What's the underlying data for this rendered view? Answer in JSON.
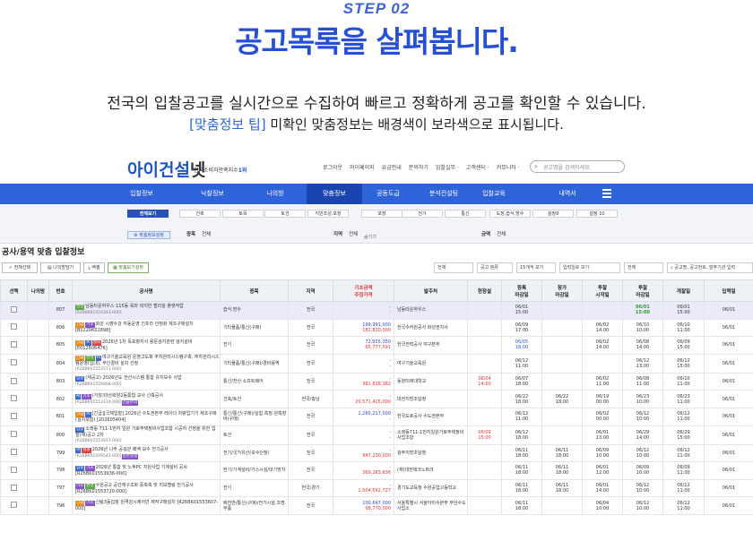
{
  "hero": {
    "step": "STEP 02",
    "headline": "공고목록을 살펴봅니다.",
    "line1": "전국의 입찰공고를 실시간으로 수집하여 빠르고 정확하게 공고를 확인할 수 있습니다.",
    "tip_label": "[맞춤정보 팁]",
    "tip_text": " 미확인 맞춤정보는 배경색이 보라색으로 표시됩니다."
  },
  "topbar": {
    "logo_main": "아이건설",
    "logo_suffix": "넷",
    "logo_sub": "한국소비자만족지수",
    "logo_sub_badge": "1위",
    "links": [
      "로그아웃",
      "마이페이지",
      "요금안내",
      "문의하기",
      "입찰실무 ·",
      "고객센터 ·",
      "커뮤니티 ·"
    ],
    "search_placeholder": "공고명을 검색하세요."
  },
  "nav": {
    "items": [
      "입찰정보",
      "낙찰정보",
      "나의방",
      "맞춤정보",
      "공동도급",
      "분석컨설팅",
      "입찰교육",
      "내역서"
    ],
    "active_index": 3
  },
  "filter": {
    "tabs": [
      "전체보기",
      "건축",
      "토목",
      "토건",
      "지반조성.포장",
      "포장",
      "전기",
      "통신",
      "도장,습식,방수",
      "설정9",
      "설정 10"
    ],
    "setting_label": "맞춤정보설정",
    "type_label": "종목",
    "type_value": "전체",
    "region_label": "지역",
    "region_value": "전체",
    "amount_label": "금액",
    "amount_value": "전체",
    "collapse_label": "숨기기"
  },
  "list_title": "공사/용역 맞춤 입찰정보",
  "toolbar": {
    "select_all": "전체선택",
    "my_room": "나의방담기",
    "excel": "엑셀",
    "custom_set": "맞춤보기설정",
    "filters": [
      "전체",
      "공고 분류",
      "15개씩 보기",
      "입력일로 보기",
      "전체"
    ],
    "search_placeholder": "공고명, 공고번호, 발주기관 입력"
  },
  "table": {
    "headers": [
      "선택",
      "나의방",
      "번호",
      "공사명",
      "종목",
      "지역",
      "기초금액",
      "발주처",
      "현장설",
      "등록 마감일",
      "참가 마감일",
      "투찰 시작일",
      "투찰 마감일",
      "개찰일",
      "입력일"
    ],
    "amount_header_sub": "추정가격",
    "rows": [
      {
        "hl": true,
        "no": "807",
        "tags": [
          [
            "t-green",
            "변경"
          ]
        ],
        "title": "남동타운하우스 115동 옥마 외지반 벨리설 플랫작업",
        "ref": "[R26BK01554343-000]",
        "type": "습식.방수",
        "region": "전국",
        "base": "-",
        "est": "-",
        "agency": "남동타운하우스",
        "site": "",
        "reg": "06/01\n15:00",
        "part": "",
        "open": "",
        "close": "06/01\n15:00",
        "close_bold": true,
        "bid": "06/01\n15:00",
        "input": "06/01"
      },
      {
        "hl": false,
        "no": "806",
        "tags": [
          [
            "t-orange",
            "긴급"
          ],
          [
            "t-purple",
            "기초"
          ]
        ],
        "title": "화성 시영수강 자동운영 인프라 안정화 제조구매설치 [B1220K01898]",
        "ref": "",
        "type": "기타물품/통신(구매)",
        "region": "전국",
        "base": "199,991,000",
        "est": "181,810,000",
        "agency": "한국수자원공사 화성권지사",
        "site": "",
        "reg": "06/09\n17:00",
        "part": "",
        "open": "06/02\n14:00",
        "close": "06/10\n10:00",
        "bid": "06/10\n11:00",
        "input": "06/01"
      },
      {
        "hl": false,
        "no": "805",
        "tags": [
          [
            "t-orange",
            "긴급"
          ],
          [
            "t-blue",
            "AI"
          ],
          [
            "t-red",
            "철회"
          ]
        ],
        "title": "2026년 1차 독포항지사 용문검지관련 검지설비 [E012606476]",
        "ref": "",
        "type": "전기",
        "region": "전국",
        "base": "72,955,350",
        "est": "65,777,591",
        "agency": "한국전력공사 여구본부",
        "site": "",
        "reg": "06/05\n18:00",
        "reg_blue": true,
        "part": "",
        "open": "06/02\n14:00",
        "close": "06/08\n14:00",
        "bid": "06/09\n15:00",
        "input": "06/01"
      },
      {
        "hl": false,
        "no": "804",
        "tags": [
          [
            "t-orange",
            "긴급"
          ],
          [
            "t-green",
            "변경"
          ],
          [
            "t-blue",
            "AI"
          ]
        ],
        "title": "여구기술교육원 운영고도화 주차관리시스템구축, 주차관리시스템운영(입대), 무인결비 설치 선정",
        "ref": "[R26BK01553571-000]",
        "type": "기타물품/통신(구매)/경비용역",
        "region": "전국",
        "base": "-",
        "est": "-",
        "agency": "여구기술교육원",
        "site": "",
        "reg": "06/12\n11:00",
        "part": "",
        "open": "",
        "close": "06/12\n13:00",
        "bid": "06/12\n15:00",
        "input": "06/01"
      },
      {
        "hl": false,
        "no": "803",
        "tags": [
          [
            "t-blue",
            "입찰"
          ]
        ],
        "title": "(재공고) 2026년도 전산시스템 통합 유지보수 사업",
        "ref": "[R26BK01556868-000]",
        "type": "통신/전산.소프트웨어",
        "region": "전국",
        "base": "-",
        "est": "361,818,182",
        "agency": "동양미래대학교",
        "site": "06/04\n14:00",
        "site_red": true,
        "reg": "06/07\n18:00",
        "part": "",
        "open": "06/02\n11:00",
        "close": "06/08\n11:00",
        "bid": "06/10\n11:00",
        "input": "06/01"
      },
      {
        "hl": false,
        "no": "802",
        "tags": [
          [
            "t-blue",
            "AI"
          ],
          [
            "t-purple",
            "기초"
          ]
        ],
        "title": "(가칭)마산화양2동통합 교사 신축공사",
        "ref": "[R26BK01553114-000]",
        "ref_extra": "긴급수의",
        "type": "건축/토건",
        "region": "전국/충남",
        "base": "-",
        "est": "20,571,425,000",
        "agency": "대전지방조달청",
        "site": "",
        "reg": "06/22\n18:00",
        "part": "06/22\n18:00",
        "open": "06/19\n00:00",
        "close": "06/23\n10:00",
        "bid": "06/23\n11:00",
        "input": "06/01"
      },
      {
        "hl": false,
        "no": "801",
        "tags": [
          [
            "t-orange",
            "긴급"
          ],
          [
            "t-blue",
            "AI"
          ]
        ],
        "title": "[긴급][국제입찰] 2026년 수도권본부 레이더 차량업기기 제조구매(설치포함) [202605404]",
        "ref": "",
        "type": "통신/통신(구매)/실험.측정.관측장비(구매)",
        "region": "전국",
        "base": "1,260,217,000",
        "est": "-",
        "agency": "한국도로공사 수도권본부",
        "site": "",
        "reg": "06/12\n11:00",
        "part": "",
        "open": "06/02\n00:00",
        "close": "06/12\n10:00",
        "bid": "06/12\n11:00",
        "input": "06/01"
      },
      {
        "hl": false,
        "no": "800",
        "tags": [
          [
            "t-blue",
            "입찰"
          ]
        ],
        "title": "소래동 711-1번지 일원 가로주택정비사업조합 시공자 선정을 위한 입찰(재)공고 2차",
        "ref": "[R26BK01553917-000]",
        "type": "토건",
        "region": "전국",
        "base": "-",
        "est": "-",
        "agency": "소래동711-1번지일원가로주택정비사업조합",
        "site": "06/09\n15:00",
        "site_red": true,
        "reg": "06/12\n18:00",
        "part": "",
        "open": "06/01\n13:00",
        "close": "06/29\n14:00",
        "bid": "06/29\n15:00",
        "input": "06/01"
      },
      {
        "hl": false,
        "no": "799",
        "tags": [
          [
            "t-blue",
            "AI"
          ],
          [
            "t-red",
            "철회"
          ]
        ],
        "title": "2026년 나주 공성관 페액 보수 전기공사",
        "ref": "[R26BK01509542-000]",
        "ref_extra": "일반경쟁",
        "type": "전기/국가유산(보수단청)",
        "region": "전국",
        "base": "-",
        "est": "947,230,000",
        "agency": "광주지방조달청",
        "site": "",
        "reg": "06/11\n18:00",
        "part": "06/11\n18:00",
        "open": "06/09\n10:00",
        "close": "06/12\n10:00",
        "bid": "06/12\n11:00",
        "input": "06/01"
      },
      {
        "hl": false,
        "no": "798",
        "tags": [
          [
            "t-blue",
            "입찰"
          ],
          [
            "t-purple",
            "기초"
          ]
        ],
        "title": "2026년 통합 및 노후PC 지원사업 기계설비 공사 [R26BK01553936-000]",
        "ref": "",
        "type": "전기/기계설비/가스시설/대기방지",
        "region": "전국",
        "base": "-",
        "est": "369,263,636",
        "agency": "(재)대전테크노파크",
        "site": "",
        "reg": "06/11\n18:00",
        "part": "06/11\n18:00",
        "open": "06/01\n12:00",
        "close": "06/09\n10:00",
        "bid": "06/09\n11:00",
        "input": "06/01"
      },
      {
        "hl": false,
        "no": "797",
        "tags": [
          [
            "t-purple",
            "기초"
          ],
          [
            "t-green",
            "변경"
          ]
        ],
        "title": "수원공고 공간재구조화 중축축 및 리모델링 전기공사 [R26BK01553720-000]",
        "ref": "",
        "type": "전기",
        "region": "전국/경기",
        "base": "-",
        "est": "1,504,592,727",
        "agency": "경기도교육청 수원공업고등학교",
        "site": "",
        "reg": "06/11\n18:00",
        "part": "06/11\n18:00",
        "open": "06/01\n14:00",
        "close": "06/12\n10:00",
        "bid": "06/12\n11:00",
        "input": "06/01"
      },
      {
        "hl": false,
        "no": "796",
        "tags": [
          [
            "t-orange",
            "긴급"
          ],
          [
            "t-purple",
            "기초"
          ]
        ],
        "title": "신림3동집장 원격감시제어반 제작구매설치 [R26BK01553607-000]",
        "ref": "",
        "type": "배전반/통신(구매)/전기시설.조명.부품",
        "region": "전국",
        "base": "100,647,000",
        "est": "98,770,000",
        "agency": "서울특별시 서울아리수본부 부산수도사업소",
        "site": "",
        "reg": "06/11\n18:00",
        "part": "",
        "open": "06/04\n10:00",
        "close": "06/12\n10:00",
        "bid": "06/12\n11:00",
        "input": "06/01"
      }
    ]
  },
  "colors": {
    "primary": "#2f63d9",
    "headline": "#2550d6",
    "highlight_row": "#eaeaf9"
  }
}
